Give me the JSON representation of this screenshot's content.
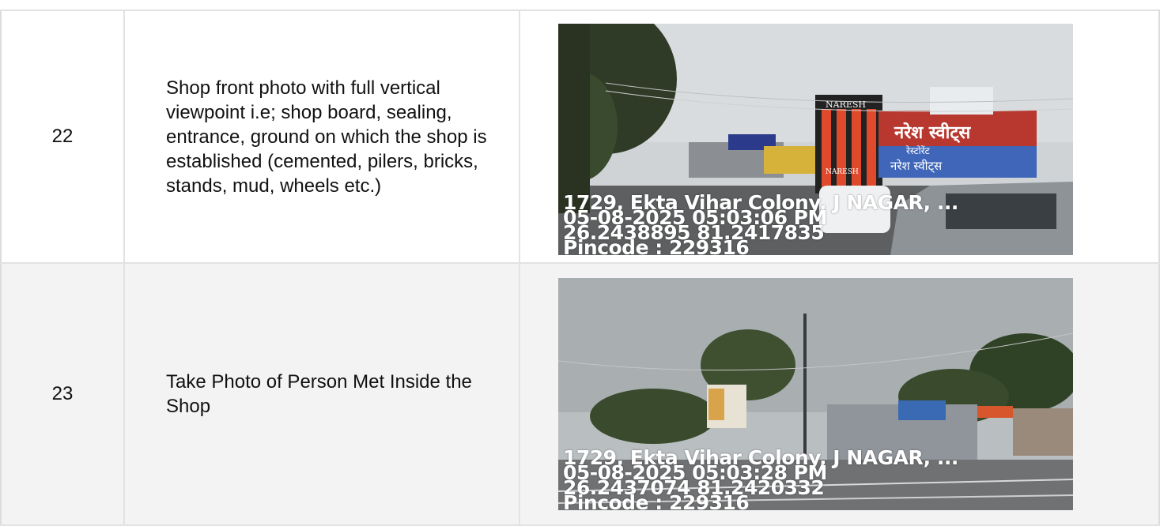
{
  "rows": [
    {
      "number": "22",
      "description": "Shop front photo with full vertical viewpoint i.e; shop board, sealing, entrance, ground on which the shop is established (cemented, pilers, bricks, stands, mud, wheels etc.)",
      "photo": {
        "scene": "storefront-street-photo",
        "stamp_lines": [
          "1729, Ekta Vihar Colony, J NAGAR, ...",
          "05-08-2025 05:03:06 PM",
          "26.2438895 81.2417835",
          "Pincode : 229316"
        ],
        "signage": [
          "NARESH",
          "नरेश स्वीट्स",
          "रेस्टोरेंट",
          "नरेश स्वीट्स",
          "NARESH"
        ]
      }
    },
    {
      "number": "23",
      "description": "Take Photo of Person Met Inside the Shop",
      "photo": {
        "scene": "street-trees-photo",
        "stamp_lines": [
          "1729, Ekta Vihar Colony, J NAGAR, ...",
          "05-08-2025 05:03:28 PM",
          "26.2437074 81.2420332",
          "Pincode : 229316"
        ]
      }
    }
  ]
}
